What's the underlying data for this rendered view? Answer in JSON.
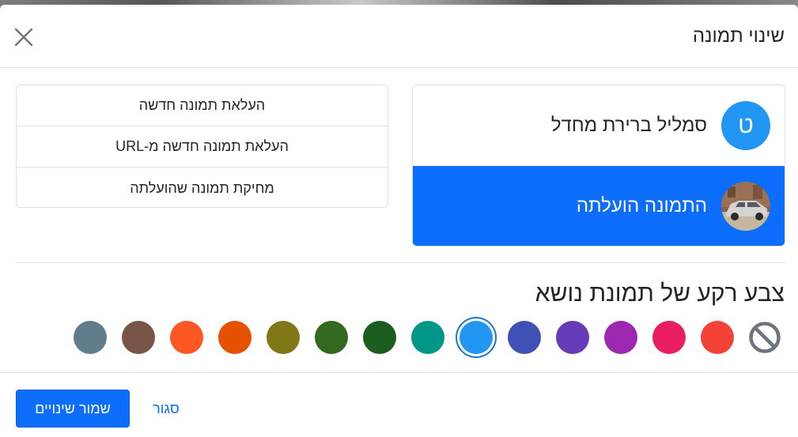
{
  "dialog": {
    "title": "שינוי תמונה"
  },
  "picture_sources": [
    {
      "label": "סמליל ברירת מחדל",
      "avatar_letter": "ט",
      "avatar_color": "#2196f3",
      "selected": false
    },
    {
      "label": "התמונה הועלתה",
      "avatar_icon": "uploaded-photo",
      "selected": true
    }
  ],
  "actions": [
    "העלאת תמונה חדשה",
    "העלאת תמונה חדשה מ-URL",
    "מחיקת תמונה שהועלתה"
  ],
  "background": {
    "heading": "צבע רקע של תמונת נושא",
    "none_icon": "no-color-icon",
    "colors": [
      {
        "hex": "#f44336"
      },
      {
        "hex": "#e91e63"
      },
      {
        "hex": "#9c27b0"
      },
      {
        "hex": "#673ab7"
      },
      {
        "hex": "#3f51b5"
      },
      {
        "hex": "#2196f3",
        "selected": true
      },
      {
        "hex": "#009688"
      },
      {
        "hex": "#1b5e20"
      },
      {
        "hex": "#33691e"
      },
      {
        "hex": "#827717"
      },
      {
        "hex": "#e65100"
      },
      {
        "hex": "#ff5722"
      },
      {
        "hex": "#795548"
      },
      {
        "hex": "#607d8b"
      }
    ]
  },
  "footer": {
    "save_label": "שמור שינויים",
    "cancel_label": "סגור"
  },
  "colors": {
    "primary": "#0d6efd"
  }
}
